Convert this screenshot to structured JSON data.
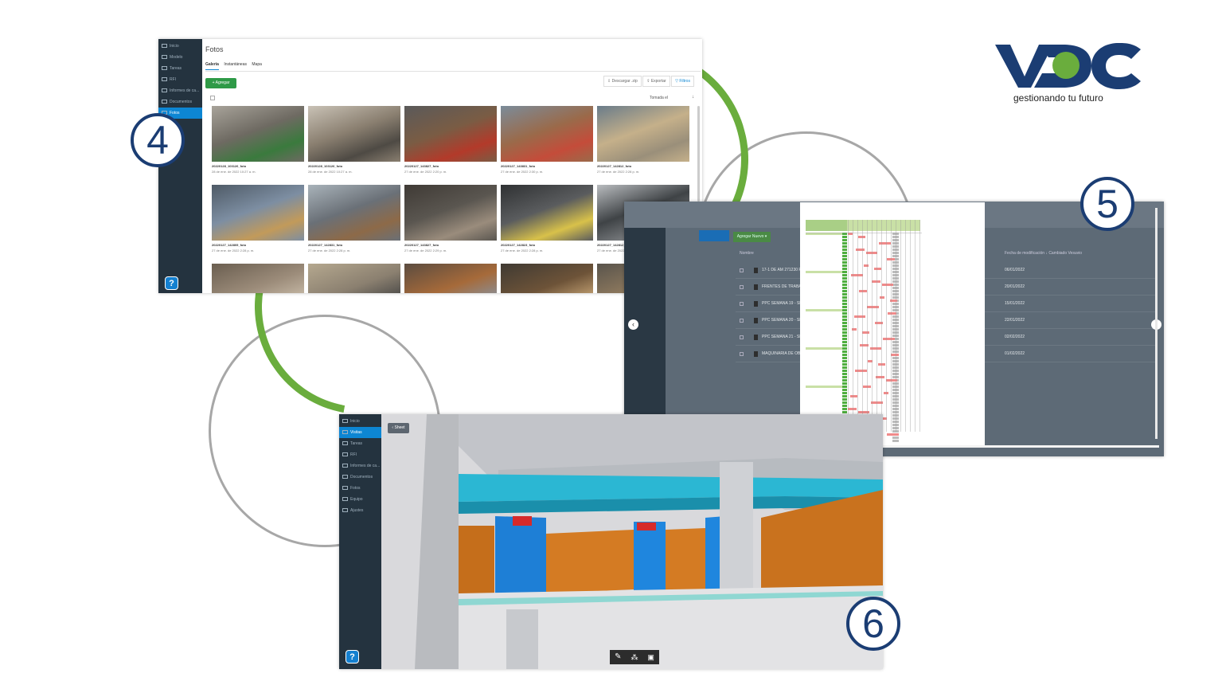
{
  "logo": {
    "wordmark": "VDC",
    "tagline": "gestionando tu futuro",
    "colors": {
      "blue": "#1b3d73",
      "green": "#6aad3d"
    }
  },
  "badges": [
    "4",
    "5",
    "6"
  ],
  "panel4": {
    "title": "Fotos",
    "tabs": [
      "Galería",
      "Instantáneas",
      "Mapa"
    ],
    "add_button": "Agregar",
    "toolbar": {
      "download": "Descargar .zip",
      "export": "Exportar",
      "filters": "Filtros"
    },
    "sort_label": "Tomada el",
    "sidebar": [
      "Inicio",
      "Modelo",
      "Tareas",
      "RFI",
      "Informes de ca...",
      "Documentos",
      "Fotos"
    ],
    "photos": [
      {
        "name": "20220128_103126_foto",
        "date": "28 de ene. de 2022 10:27 a. m."
      },
      {
        "name": "20220128_103126_foto",
        "date": "28 de ene. de 2022 10:27 a. m."
      },
      {
        "name": "20220127_143827_foto",
        "date": "27 de ene. de 2022 2:20 p. m."
      },
      {
        "name": "20220127_143831_foto",
        "date": "27 de ene. de 2022 2:30 p. m."
      },
      {
        "name": "20220127_142812_foto",
        "date": "27 de ene. de 2022 2:28 p. m."
      },
      {
        "name": "20220127_142805_foto",
        "date": "27 de ene. de 2022 2:28 p. m."
      },
      {
        "name": "20220127_142831_foto",
        "date": "27 de ene. de 2022 2:28 p. m."
      },
      {
        "name": "20220127_143827_foto",
        "date": "27 de ene. de 2022 2:29 p. m."
      },
      {
        "name": "20220127_142823_foto",
        "date": "27 de ene. de 2022 2:28 p. m."
      },
      {
        "name": "20220127_142812_foto",
        "date": "27 de ene. de 2022 2:28 p. m."
      }
    ]
  },
  "panel5": {
    "add_button": "Agregar Nuevo",
    "col_name": "Nombre",
    "col_modified": "Fecha de modificación",
    "col_modified_by": "Cambiado Vesuvio",
    "files": [
      {
        "name": "17-1 DE AM 271230 PE",
        "date": "06/01/2022"
      },
      {
        "name": "FRENTES DE TRABAJO",
        "date": "20/01/2022"
      },
      {
        "name": "PPC SEMANA 19 - SEM",
        "date": "15/01/2022"
      },
      {
        "name": "PPC SEMANA 20 - SEM",
        "date": "22/01/2022"
      },
      {
        "name": "PPC SEMANA 21 - SEM",
        "date": "02/02/2022"
      },
      {
        "name": "MAQUINARIA DE OBRA",
        "date": "01/02/2022"
      }
    ]
  },
  "panel6": {
    "sheet_button": "Sheet",
    "sidebar": [
      "Inicio",
      "Visitas",
      "Tareas",
      "RFI",
      "Informes de ca...",
      "Documentos",
      "Fotos",
      "Equipo",
      "Ajustes"
    ],
    "tools": [
      "pencil-icon",
      "network-icon",
      "clipboard-icon"
    ]
  }
}
